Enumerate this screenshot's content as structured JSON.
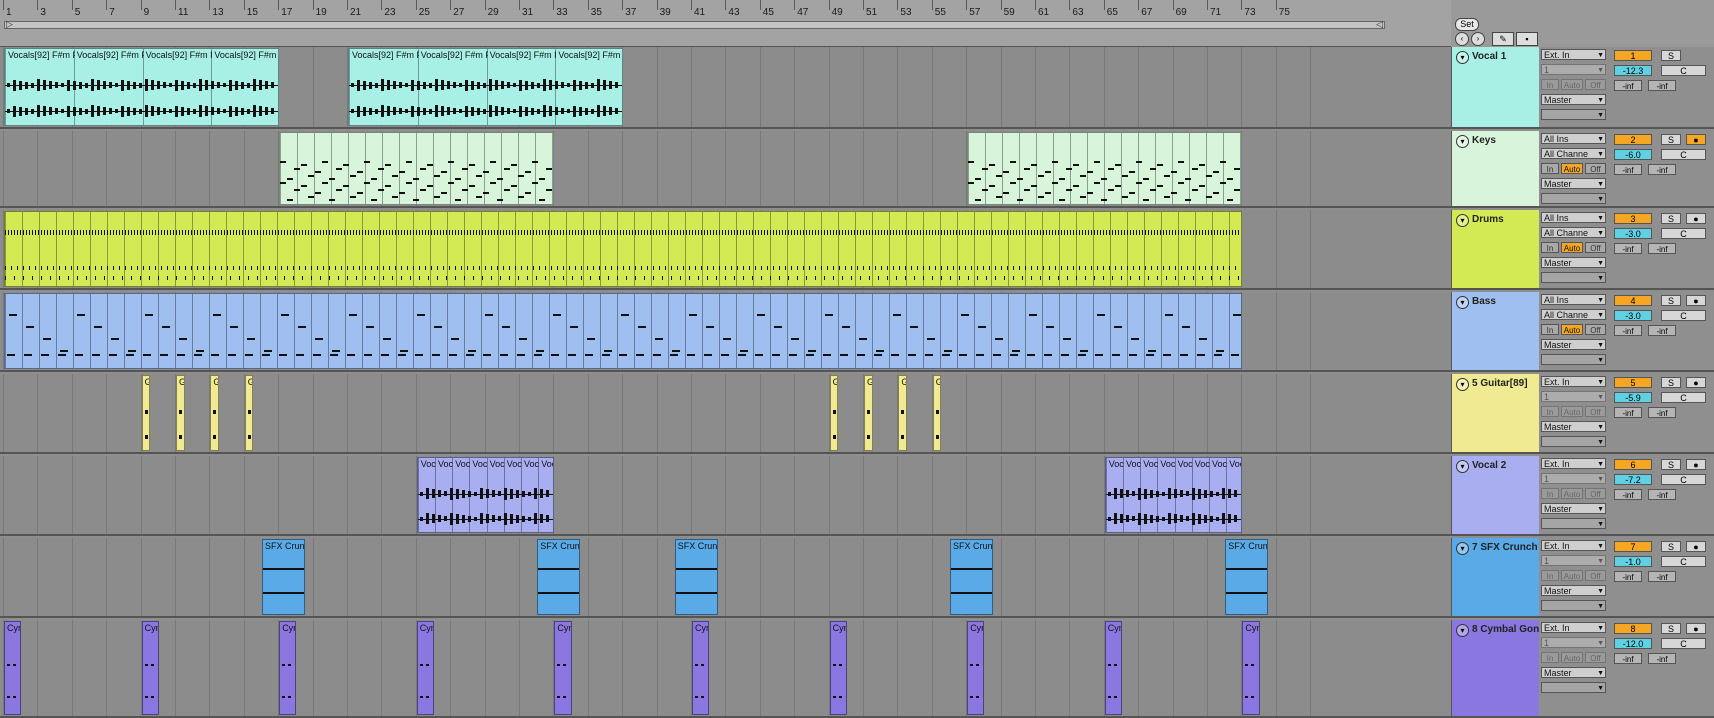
{
  "ruler": {
    "bars": [
      "1",
      "3",
      "5",
      "7",
      "9",
      "11",
      "13",
      "15",
      "17",
      "19",
      "21",
      "23",
      "25",
      "27",
      "29",
      "31",
      "33",
      "35",
      "37",
      "39",
      "41",
      "43",
      "45",
      "47",
      "49",
      "51",
      "53",
      "55",
      "57",
      "59",
      "61",
      "63",
      "65",
      "67",
      "69",
      "71",
      "73",
      "75"
    ],
    "loop_start": "▷",
    "loop_end": "◁"
  },
  "set_controls": {
    "set_label": "Set",
    "back_icon": "arrow-left-circle-icon",
    "fwd_icon": "arrow-right-circle-icon",
    "draw_icon": "pencil-icon",
    "lock_icon": "lock-icon"
  },
  "tracks": [
    {
      "name": "Vocal 1",
      "color": "#a8f0e6",
      "input_type": "Ext. In",
      "input_channel": "1",
      "output": "Master",
      "monitor": [
        "In",
        "Auto",
        "Off"
      ],
      "monitor_active": "",
      "number": "1",
      "solo": "S",
      "arm": "",
      "volume": "-12.3",
      "pan": "C",
      "meter_l": "-inf",
      "meter_r": "-inf",
      "clips": [
        {
          "title": "Vocals[92] F#m F",
          "start": 1,
          "end": 33,
          "type": "audio",
          "segments": [
            "Vocals[92] F#m F",
            "Vocals[92] F#m F",
            "Vocals[92] F#m F",
            "Vocals[92] F#m F"
          ]
        },
        {
          "title": "Vocals[92] F#m F",
          "start": 41,
          "end": 73,
          "type": "audio",
          "segments": [
            "Vocals[92] F#m F",
            "Vocals[92] F#m F",
            "Vocals[92] F#m F",
            "Vocals[92] F#m F"
          ]
        }
      ]
    },
    {
      "name": "Keys",
      "color": "#d8f5dc",
      "input_type": "All Ins",
      "input_channel": "All Channe",
      "output": "Master",
      "monitor": [
        "In",
        "Auto",
        "Off"
      ],
      "monitor_active": "Auto",
      "number": "2",
      "solo": "S",
      "arm": "●",
      "volume": "-6.0",
      "pan": "C",
      "meter_l": "-inf",
      "meter_r": "-inf",
      "clips": [
        {
          "title": "",
          "start": 33,
          "end": 65,
          "type": "midi",
          "segments": []
        },
        {
          "title": "",
          "start": 113,
          "end": 145,
          "type": "midi",
          "segments": []
        }
      ]
    },
    {
      "name": "Drums",
      "color": "#d4ea55",
      "input_type": "All Ins",
      "input_channel": "All Channe",
      "output": "Master",
      "monitor": [
        "In",
        "Auto",
        "Off"
      ],
      "monitor_active": "Auto",
      "number": "3",
      "solo": "S",
      "arm": "●",
      "volume": "-3.0",
      "pan": "C",
      "meter_l": "-inf",
      "meter_r": "-inf",
      "clips": [
        {
          "title": "",
          "start": 1,
          "end": 145,
          "type": "drums",
          "segments": []
        }
      ]
    },
    {
      "name": "Bass",
      "color": "#9fbff0",
      "input_type": "All Ins",
      "input_channel": "All Channe",
      "output": "Master",
      "monitor": [
        "In",
        "Auto",
        "Off"
      ],
      "monitor_active": "Auto",
      "number": "4",
      "solo": "S",
      "arm": "●",
      "volume": "-3.0",
      "pan": "C",
      "meter_l": "-inf",
      "meter_r": "-inf",
      "clips": [
        {
          "title": "",
          "start": 1,
          "end": 145,
          "type": "bass",
          "segments": []
        }
      ]
    },
    {
      "name": "5 Guitar[89]",
      "color": "#f0ea92",
      "input_type": "Ext. In",
      "input_channel": "1",
      "output": "Master",
      "monitor": [
        "In",
        "Auto",
        "Off"
      ],
      "monitor_active": "",
      "number": "5",
      "solo": "S",
      "arm": "●",
      "volume": "-5.9",
      "pan": "C",
      "meter_l": "-inf",
      "meter_r": "-inf",
      "clips": [
        {
          "title": "G",
          "start": 17,
          "end": 18,
          "type": "stab",
          "segments": []
        },
        {
          "title": "G",
          "start": 21,
          "end": 22,
          "type": "stab",
          "segments": []
        },
        {
          "title": "G",
          "start": 25,
          "end": 26,
          "type": "stab",
          "segments": []
        },
        {
          "title": "G",
          "start": 29,
          "end": 30,
          "type": "stab",
          "segments": []
        },
        {
          "title": "G",
          "start": 97,
          "end": 98,
          "type": "stab",
          "segments": []
        },
        {
          "title": "G",
          "start": 101,
          "end": 102,
          "type": "stab",
          "segments": []
        },
        {
          "title": "G",
          "start": 105,
          "end": 106,
          "type": "stab",
          "segments": []
        },
        {
          "title": "G",
          "start": 109,
          "end": 110,
          "type": "stab",
          "segments": []
        }
      ]
    },
    {
      "name": "Vocal 2",
      "color": "#a8aef0",
      "input_type": "Ext. In",
      "input_channel": "1",
      "output": "Master",
      "monitor": [
        "In",
        "Auto",
        "Off"
      ],
      "monitor_active": "",
      "number": "6",
      "solo": "S",
      "arm": "●",
      "volume": "-7.2",
      "pan": "C",
      "meter_l": "-inf",
      "meter_r": "-inf",
      "clips": [
        {
          "title": "Voc",
          "start": 49,
          "end": 65,
          "type": "audio",
          "segments": [
            "Voc",
            "Voc",
            "Voc",
            "Voc",
            "Voc",
            "Voc",
            "Voc",
            "Voc"
          ]
        },
        {
          "title": "Voc",
          "start": 129,
          "end": 145,
          "type": "audio",
          "segments": [
            "Voc",
            "Voc",
            "Voc",
            "Voc",
            "Voc",
            "Voc",
            "Voc",
            "Voc"
          ]
        }
      ]
    },
    {
      "name": "7 SFX Crunch",
      "color": "#5aaae8",
      "input_type": "Ext. In",
      "input_channel": "1",
      "output": "Master",
      "monitor": [
        "In",
        "Auto",
        "Off"
      ],
      "monitor_active": "",
      "number": "7",
      "solo": "S",
      "arm": "●",
      "volume": "-1.0",
      "pan": "C",
      "meter_l": "-inf",
      "meter_r": "-inf",
      "clips": [
        {
          "title": "SFX Crunc",
          "start": 31,
          "end": 36,
          "type": "sfx",
          "segments": []
        },
        {
          "title": "SFX Crunc",
          "start": 63,
          "end": 68,
          "type": "sfx",
          "segments": []
        },
        {
          "title": "SFX Crunc",
          "start": 79,
          "end": 84,
          "type": "sfx",
          "segments": []
        },
        {
          "title": "SFX Crunc",
          "start": 111,
          "end": 116,
          "type": "sfx",
          "segments": []
        },
        {
          "title": "SFX Crunc",
          "start": 143,
          "end": 148,
          "type": "sfx",
          "segments": []
        }
      ]
    },
    {
      "name": "8 Cymbal Gon",
      "color": "#8a78e0",
      "input_type": "Ext. In",
      "input_channel": "1",
      "output": "Master",
      "monitor": [
        "In",
        "Auto",
        "Off"
      ],
      "monitor_active": "",
      "number": "8",
      "solo": "S",
      "arm": "●",
      "volume": "-12.0",
      "pan": "C",
      "meter_l": "-inf",
      "meter_r": "-inf",
      "clips": [
        {
          "title": "Cym",
          "start": 1,
          "end": 3,
          "type": "cym",
          "segments": []
        },
        {
          "title": "Cym",
          "start": 17,
          "end": 19,
          "type": "cym",
          "segments": []
        },
        {
          "title": "Cym",
          "start": 33,
          "end": 35,
          "type": "cym",
          "segments": []
        },
        {
          "title": "Cym",
          "start": 49,
          "end": 51,
          "type": "cym",
          "segments": []
        },
        {
          "title": "Cym",
          "start": 65,
          "end": 67,
          "type": "cym",
          "segments": []
        },
        {
          "title": "Cym",
          "start": 81,
          "end": 83,
          "type": "cym",
          "segments": []
        },
        {
          "title": "Cym",
          "start": 97,
          "end": 99,
          "type": "cym",
          "segments": []
        },
        {
          "title": "Cym",
          "start": 113,
          "end": 115,
          "type": "cym",
          "segments": []
        },
        {
          "title": "Cym",
          "start": 129,
          "end": 131,
          "type": "cym",
          "segments": []
        },
        {
          "title": "Cym",
          "start": 145,
          "end": 147,
          "type": "cym",
          "segments": []
        }
      ]
    }
  ]
}
